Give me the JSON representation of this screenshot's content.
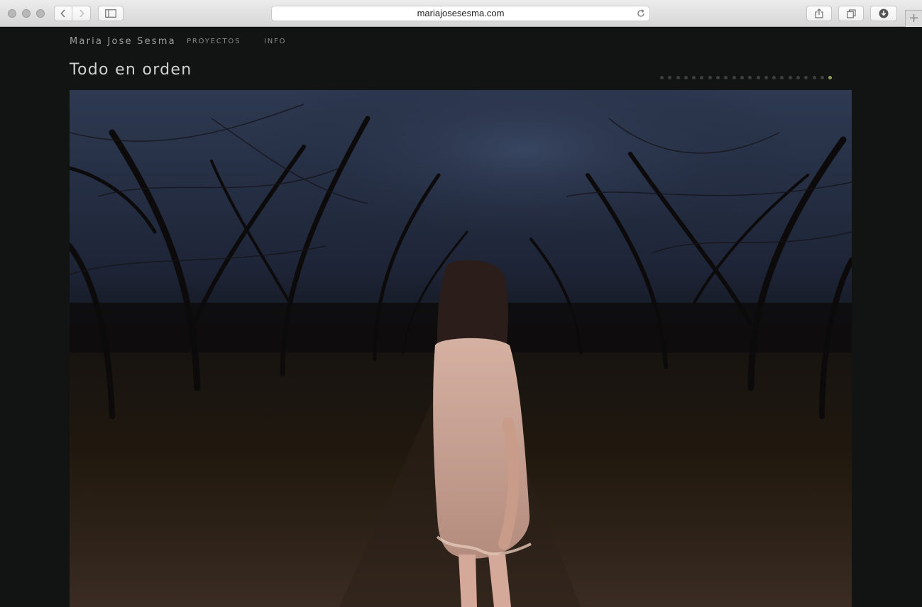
{
  "browser": {
    "url": "mariajosesesma.com"
  },
  "site": {
    "name": "Maria Jose Sesma",
    "nav": [
      "PROYECTOS",
      "INFO"
    ]
  },
  "project": {
    "title": "Todo en orden",
    "slides_total": 22,
    "active_slide": 22
  },
  "colors": {
    "background": "#121413",
    "active_dot": "#8b9e52",
    "inactive_dot": "#3b403d"
  }
}
